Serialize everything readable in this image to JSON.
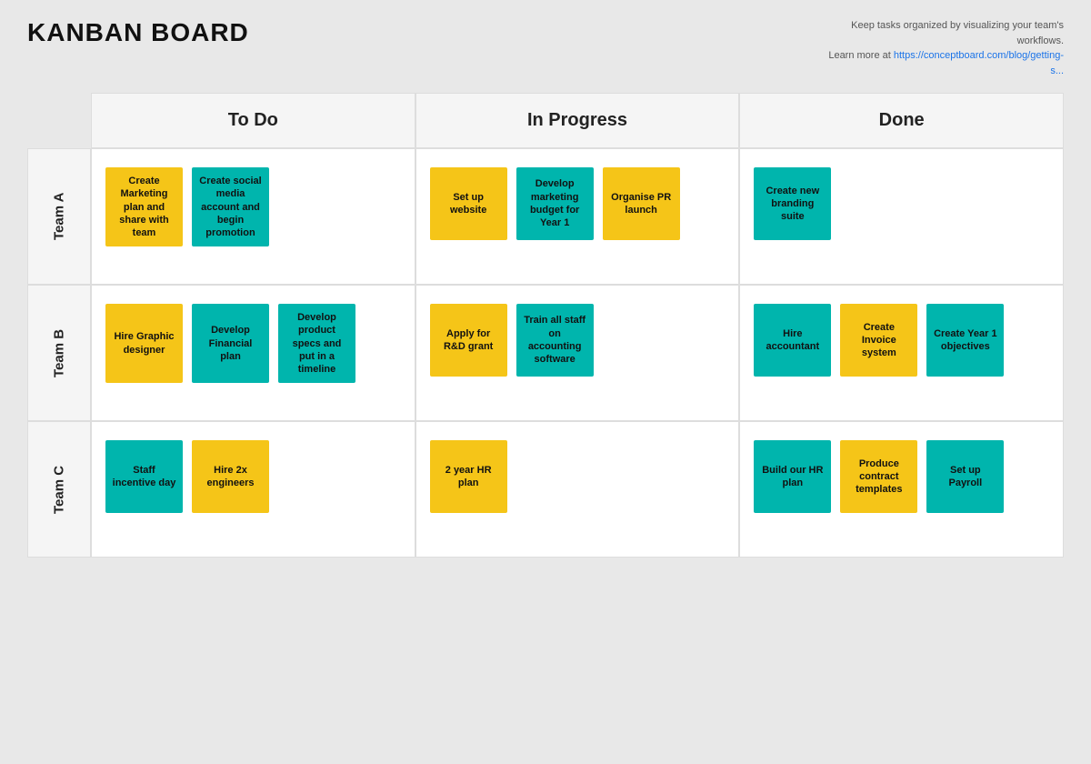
{
  "header": {
    "title": "KANBAN BOARD",
    "note_line1": "Keep tasks organized by visualizing your team's workflows.",
    "note_line2": "Learn more at ",
    "note_link": "https://conceptboard.com/blog/getting-s...",
    "note_link_display": "https://conceptboard.com/blog/getting-s..."
  },
  "columns": [
    {
      "label": "To Do"
    },
    {
      "label": "In Progress"
    },
    {
      "label": "Done"
    }
  ],
  "rows": [
    {
      "label": "Team A",
      "todo": [
        {
          "text": "Create Marketing plan and share with team",
          "color": "yellow"
        },
        {
          "text": "Create social media account and begin promotion",
          "color": "teal"
        }
      ],
      "inprogress": [
        {
          "text": "Set up website",
          "color": "yellow"
        },
        {
          "text": "Develop marketing budget for Year 1",
          "color": "teal"
        },
        {
          "text": "Organise PR launch",
          "color": "yellow"
        }
      ],
      "done": [
        {
          "text": "Create new branding suite",
          "color": "teal"
        }
      ]
    },
    {
      "label": "Team B",
      "todo": [
        {
          "text": "Hire Graphic designer",
          "color": "yellow"
        },
        {
          "text": "Develop Financial plan",
          "color": "teal"
        },
        {
          "text": "Develop product specs and put in a timeline",
          "color": "teal"
        }
      ],
      "inprogress": [
        {
          "text": "Apply for R&D grant",
          "color": "yellow"
        },
        {
          "text": "Train all staff on accounting software",
          "color": "teal"
        }
      ],
      "done": [
        {
          "text": "Hire accountant",
          "color": "teal"
        },
        {
          "text": "Create Invoice system",
          "color": "yellow"
        },
        {
          "text": "Create Year 1 objectives",
          "color": "teal"
        }
      ]
    },
    {
      "label": "Team C",
      "todo": [
        {
          "text": "Staff incentive day",
          "color": "teal"
        },
        {
          "text": "Hire 2x engineers",
          "color": "yellow"
        }
      ],
      "inprogress": [
        {
          "text": "2 year HR plan",
          "color": "yellow"
        }
      ],
      "done": [
        {
          "text": "Build our HR plan",
          "color": "teal"
        },
        {
          "text": "Produce contract templates",
          "color": "yellow"
        },
        {
          "text": "Set up Payroll",
          "color": "teal"
        }
      ]
    }
  ]
}
